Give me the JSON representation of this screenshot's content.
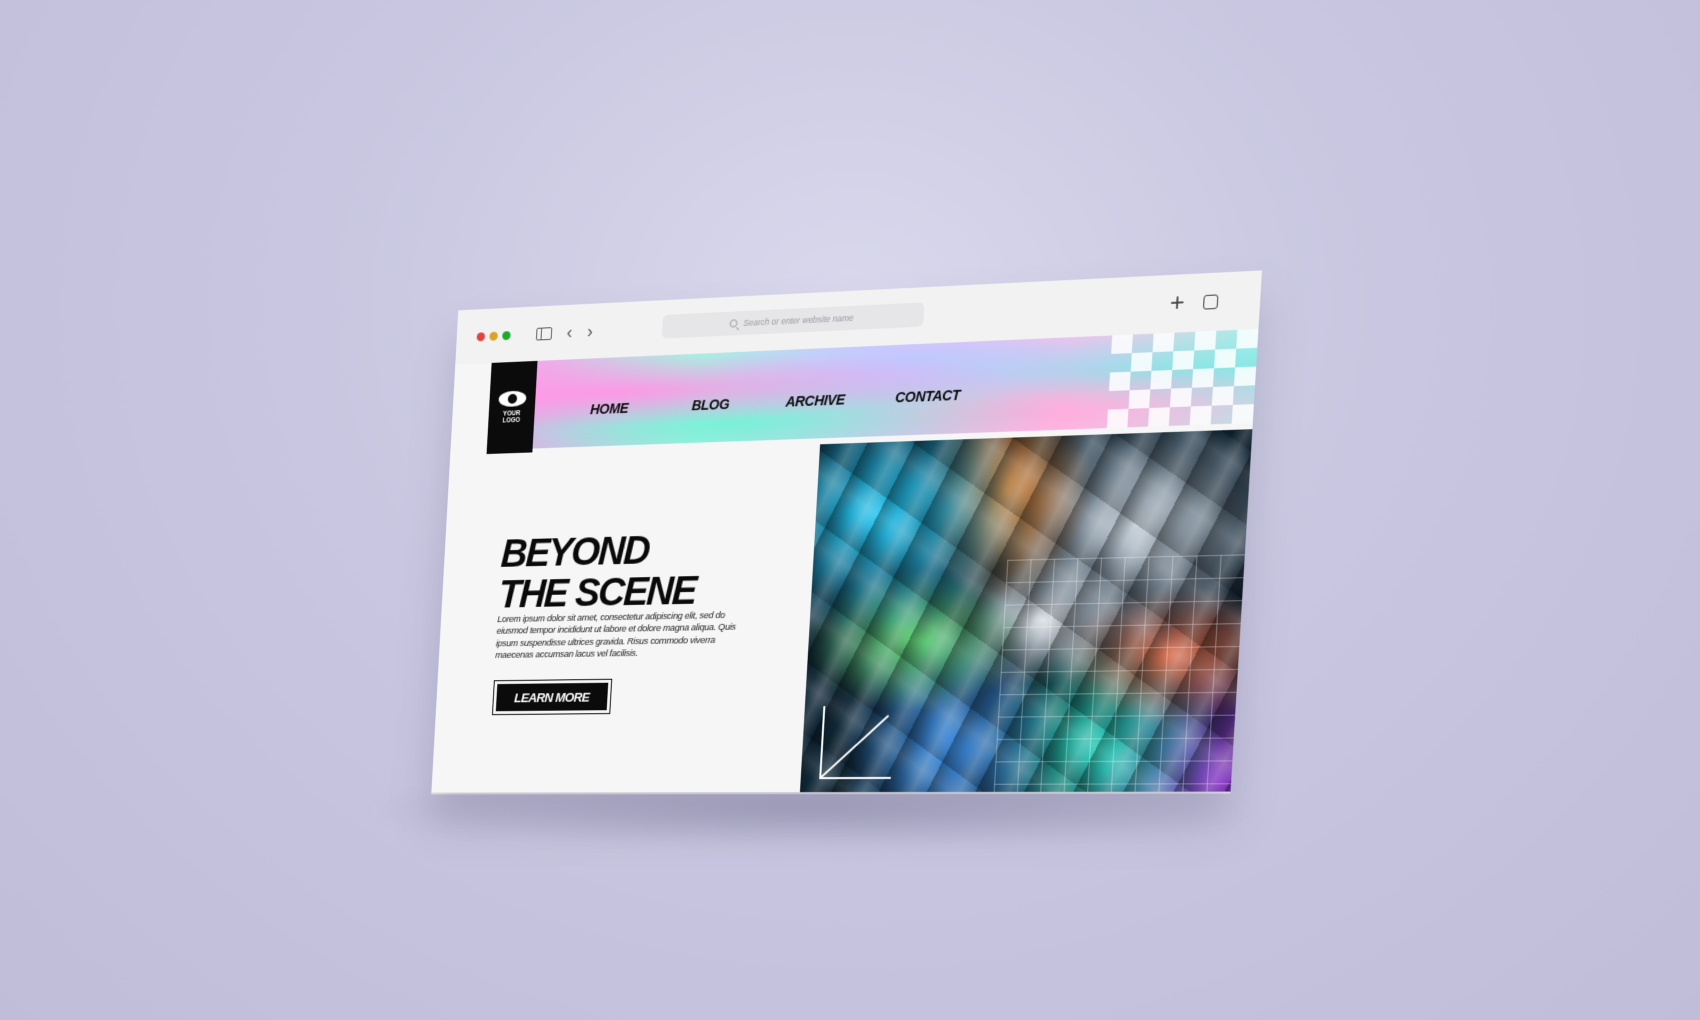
{
  "browser": {
    "address_placeholder": "Search or enter website name",
    "traffic_lights": {
      "close": "#e0443e",
      "minimize": "#dea123",
      "zoom": "#1aab29"
    },
    "icons": [
      "sidebar-icon",
      "chevron-left-icon",
      "chevron-right-icon",
      "plus-icon",
      "tabs-icon"
    ]
  },
  "site": {
    "logo_text": "YOUR\nLOGO",
    "nav": {
      "home": "HOME",
      "blog": "BLOG",
      "archive": "ARCHIVE",
      "contact": "CONTACT"
    },
    "hero": {
      "headline_line1": "BEYOND",
      "headline_line2": "THE SCENE",
      "body": "Lorem ipsum dolor sit amet, consectetur adipiscing elit, sed do eiusmod tempor incididunt ut labore et dolore magna aliqua. Quis ipsum suspendisse ultrices gravida. Risus commodo viverra maecenas accumsan lacus vel facilisis.",
      "cta_label": "LEARN MORE"
    },
    "colors": {
      "ink": "#0b0b0b",
      "background": "#f6f6f6"
    }
  }
}
